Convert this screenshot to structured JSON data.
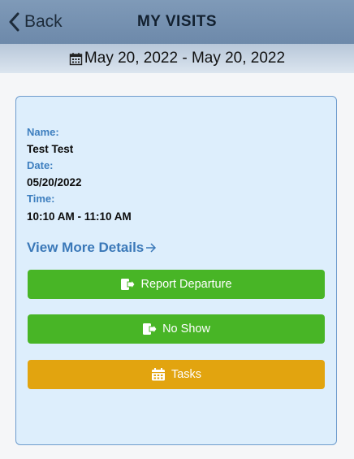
{
  "header": {
    "back_label": "Back",
    "title": "MY VISITS"
  },
  "date_bar": {
    "icon": "calendar-icon",
    "range": "May 20, 2022 - May 20, 2022"
  },
  "visit": {
    "name_label": "Name:",
    "name": "Test Test",
    "date_label": "Date:",
    "date": "05/20/2022",
    "time_label": "Time:",
    "time": "10:10 AM - 11:10 AM",
    "more_details": "View More Details"
  },
  "actions": [
    {
      "label": "Report Departure",
      "icon": "exit-icon",
      "color": "#48b526"
    },
    {
      "label": "No Show",
      "icon": "exit-icon",
      "color": "#48b526"
    },
    {
      "label": "Tasks",
      "icon": "calendar-icon",
      "color": "#e2a40f"
    }
  ],
  "colors": {
    "header": "#7f9ab8",
    "label_blue": "#3e7fbf",
    "card_bg": "#ddeefc",
    "card_border": "#6e9ccd"
  }
}
